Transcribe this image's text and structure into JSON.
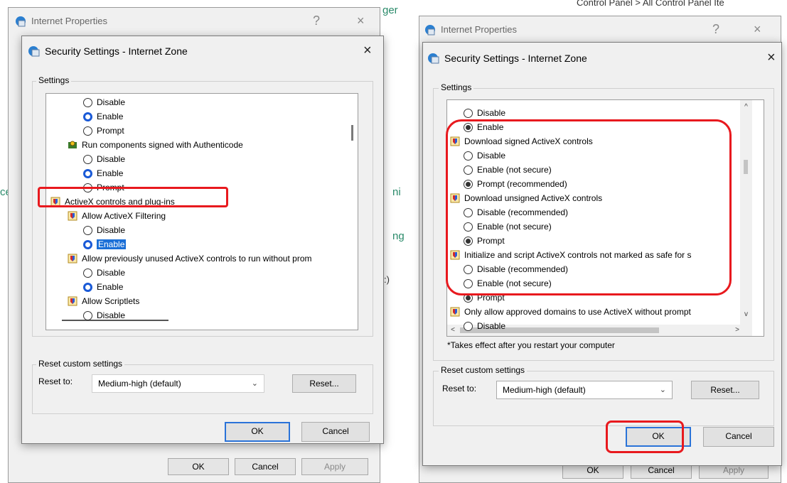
{
  "left": {
    "bg_title": "Internet Properties",
    "bg_help": "?",
    "bg_close": "×",
    "bg_snippets": [
      "ger",
      "ce",
      "ni",
      "ng",
      ":)"
    ],
    "bg_buttons": {
      "ok": "OK",
      "cancel": "Cancel",
      "apply": "Apply"
    },
    "dialog_title": "Security Settings - Internet Zone",
    "dialog_close": "×",
    "settings_label": "Settings",
    "rows": [
      {
        "kind": "radio",
        "text": "Disable",
        "state": "off"
      },
      {
        "kind": "radio",
        "text": "Enable",
        "state": "on"
      },
      {
        "kind": "radio",
        "text": "Prompt",
        "state": "off"
      },
      {
        "kind": "item",
        "text": "Run components signed with Authenticode",
        "icon": "authenticode-icon"
      },
      {
        "kind": "radio",
        "text": "Disable",
        "state": "off"
      },
      {
        "kind": "radio",
        "text": "Enable",
        "state": "on"
      },
      {
        "kind": "radio",
        "text": "Prompt",
        "state": "off"
      },
      {
        "kind": "category",
        "text": "ActiveX controls and plug-ins",
        "icon": "shield-icon"
      },
      {
        "kind": "item",
        "text": "Allow ActiveX Filtering",
        "icon": "shield-icon"
      },
      {
        "kind": "radio",
        "text": "Disable",
        "state": "off"
      },
      {
        "kind": "radio",
        "text": "Enable",
        "state": "on",
        "highlight": true
      },
      {
        "kind": "item",
        "text": "Allow previously unused ActiveX controls to run without prom",
        "icon": "shield-icon"
      },
      {
        "kind": "radio",
        "text": "Disable",
        "state": "off"
      },
      {
        "kind": "radio",
        "text": "Enable",
        "state": "on"
      },
      {
        "kind": "item",
        "text": "Allow Scriptlets",
        "icon": "shield-icon"
      },
      {
        "kind": "radio",
        "text": "Disable",
        "state": "off"
      }
    ],
    "reset_group_label": "Reset custom settings",
    "reset_to_label": "Reset to:",
    "reset_select_value": "Medium-high (default)",
    "reset_button": "Reset...",
    "ok": "OK",
    "cancel": "Cancel"
  },
  "right": {
    "bg_snippet": "Control Panel > All Control Panel Ite",
    "bg_title": "Internet Properties",
    "bg_help": "?",
    "bg_close": "×",
    "bg_buttons": {
      "ok": "OK",
      "cancel": "Cancel",
      "apply": "Apply"
    },
    "dialog_title": "Security Settings - Internet Zone",
    "dialog_close": "×",
    "settings_label": "Settings",
    "rows": [
      {
        "kind": "radio",
        "text": "Disable",
        "state": "off"
      },
      {
        "kind": "radio",
        "text": "Enable",
        "state": "on"
      },
      {
        "kind": "item",
        "text": "Download signed ActiveX controls",
        "icon": "shield-icon"
      },
      {
        "kind": "radio",
        "text": "Disable",
        "state": "off"
      },
      {
        "kind": "radio",
        "text": "Enable (not secure)",
        "state": "off"
      },
      {
        "kind": "radio",
        "text": "Prompt (recommended)",
        "state": "on"
      },
      {
        "kind": "item",
        "text": "Download unsigned ActiveX controls",
        "icon": "shield-icon"
      },
      {
        "kind": "radio",
        "text": "Disable (recommended)",
        "state": "off"
      },
      {
        "kind": "radio",
        "text": "Enable (not secure)",
        "state": "off"
      },
      {
        "kind": "radio",
        "text": "Prompt",
        "state": "on"
      },
      {
        "kind": "item",
        "text": "Initialize and script ActiveX controls not marked as safe for s",
        "icon": "shield-icon"
      },
      {
        "kind": "radio",
        "text": "Disable (recommended)",
        "state": "off"
      },
      {
        "kind": "radio",
        "text": "Enable (not secure)",
        "state": "off"
      },
      {
        "kind": "radio",
        "text": "Prompt",
        "state": "on"
      },
      {
        "kind": "item",
        "text": "Only allow approved domains to use ActiveX without prompt",
        "icon": "shield-icon"
      },
      {
        "kind": "radio",
        "text": "Disable",
        "state": "off"
      }
    ],
    "scroll_up": "^",
    "scroll_down": "v",
    "scroll_left": "<",
    "scroll_right": ">",
    "restart_note": "*Takes effect after you restart your computer",
    "reset_group_label": "Reset custom settings",
    "reset_to_label": "Reset to:",
    "reset_select_value": "Medium-high (default)",
    "reset_button": "Reset...",
    "ok": "OK",
    "cancel": "Cancel"
  },
  "colors": {
    "annotation_red": "#e8191e",
    "selected_blue": "#1a5ad7",
    "highlight_blue": "#1a6fd7"
  }
}
